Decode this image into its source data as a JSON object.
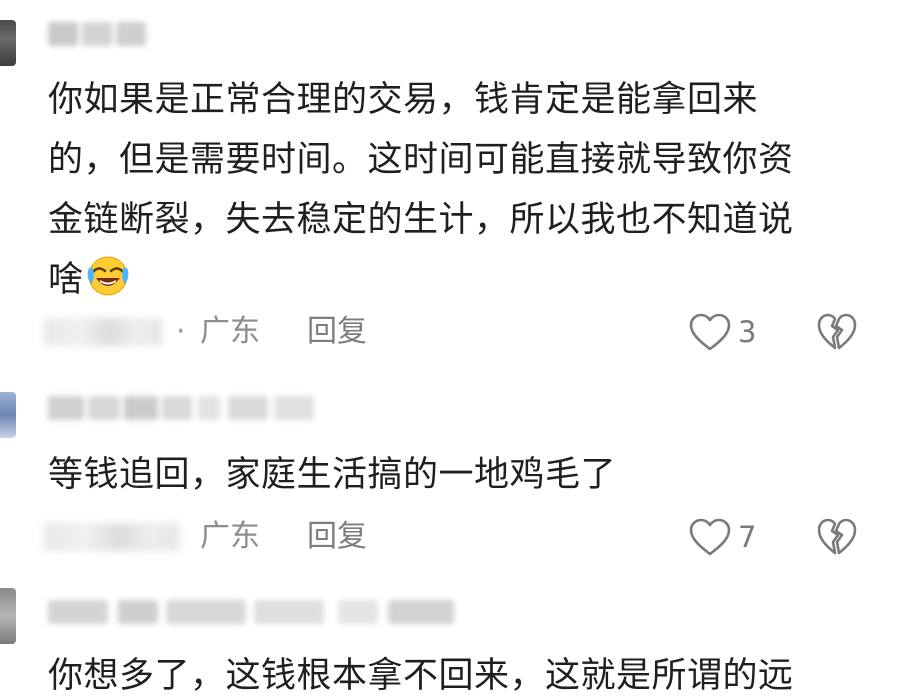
{
  "comments": [
    {
      "text_lines": [
        "你如果是正常合理的交易，钱肯定是能拿回来",
        "的，但是需要时间。这时间可能直接就导致你资",
        "金链断裂，失去稳定的生计，所以我也不知道说",
        "啥"
      ],
      "emoji": "laugh-cry-emoji",
      "meta_separator": "·",
      "region": "广东",
      "reply_label": "回复",
      "like_count": "3"
    },
    {
      "text_lines": [
        "等钱追回，家庭生活搞的一地鸡毛了"
      ],
      "region": "广东",
      "reply_label": "回复",
      "like_count": "7"
    },
    {
      "text_lines": [
        "你想多了，这钱根本拿不回来，这就是所谓的远"
      ]
    }
  ],
  "icons": {
    "like": "heart-outline-icon",
    "dislike": "broken-heart-icon"
  },
  "colors": {
    "text": "#1f1f1f",
    "meta": "#8d8d8d",
    "icon": "#7a7a7a"
  }
}
